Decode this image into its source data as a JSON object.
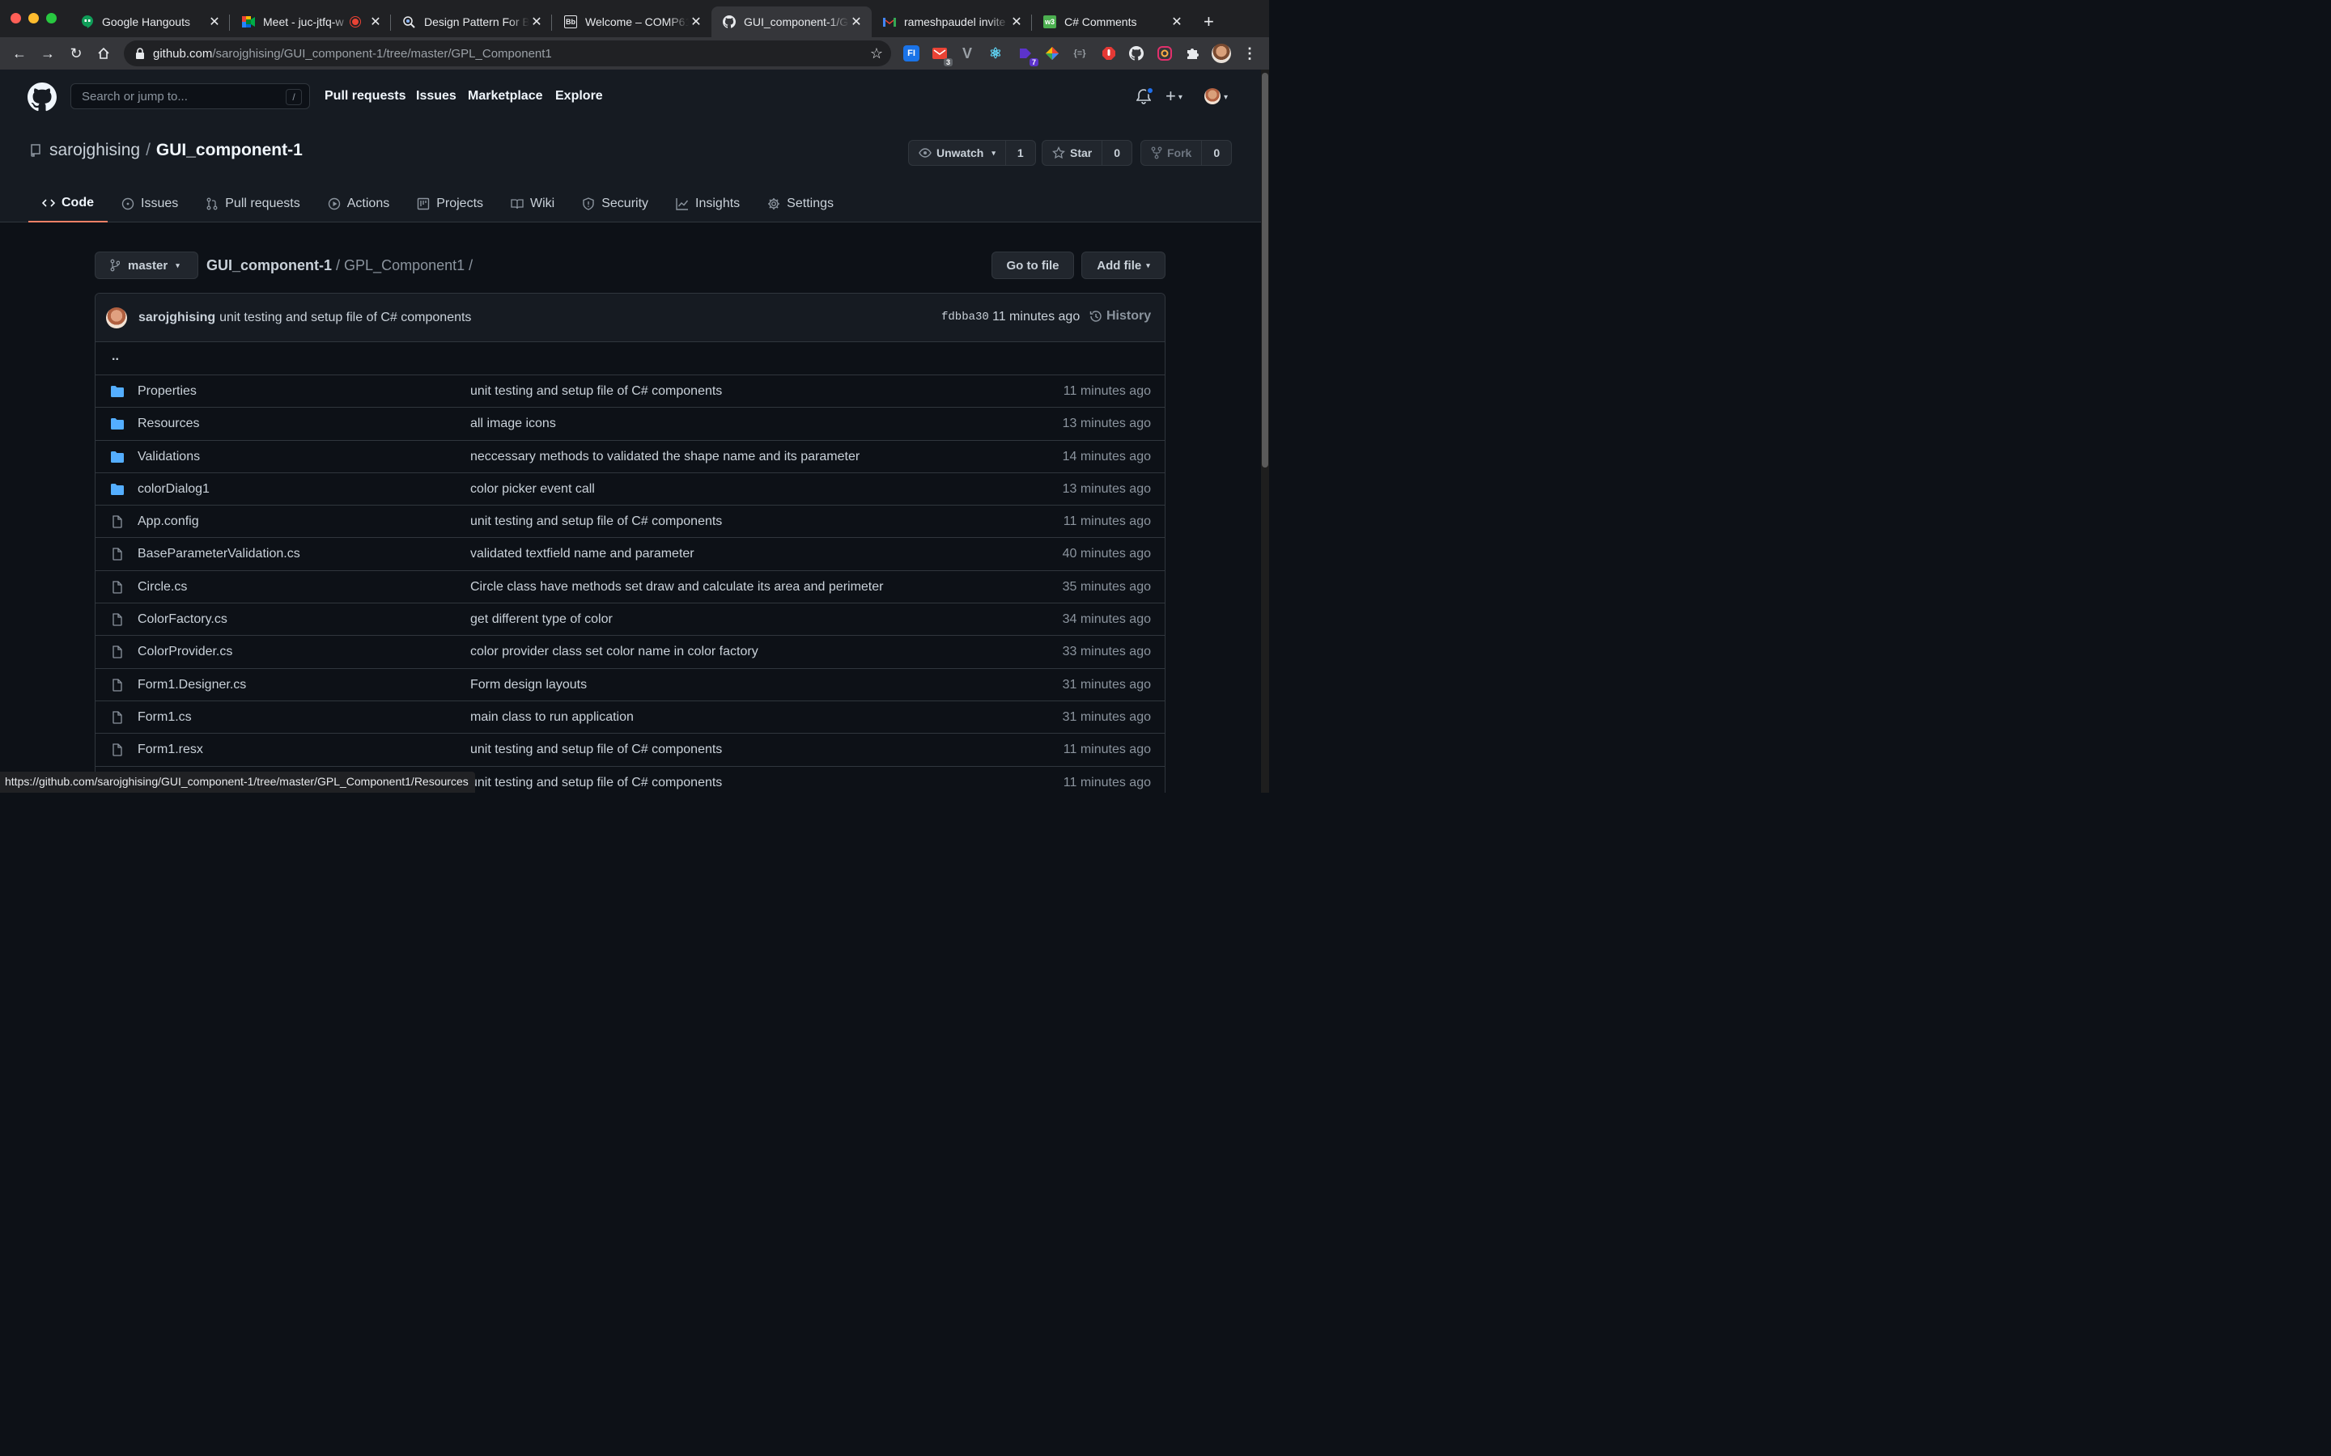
{
  "browser": {
    "tabs": [
      {
        "title": "Google Hangouts",
        "icon": "hangouts-icon"
      },
      {
        "title": "Meet - juc-jtfq-w",
        "icon": "meet-icon"
      },
      {
        "title": "Design Pattern For B",
        "icon": "design-icon"
      },
      {
        "title": "Welcome – COMP61",
        "icon": "welcome-icon"
      },
      {
        "title": "GUI_component-1/G",
        "icon": "github-icon"
      },
      {
        "title": "rameshpaudel invite",
        "icon": "gmail-icon"
      },
      {
        "title": "C# Comments",
        "icon": "csharp-icon"
      }
    ],
    "url_host": "github.com",
    "url_path": "/sarojghising/GUI_component-1/tree/master/GPL_Component1",
    "extensions": [
      "FI",
      "3",
      "7"
    ],
    "status_url": "https://github.com/sarojghising/GUI_component-1/tree/master/GPL_Component1/Resources"
  },
  "header": {
    "search_placeholder": "Search or jump to...",
    "slash": "/",
    "nav": [
      "Pull requests",
      "Issues",
      "Marketplace",
      "Explore"
    ]
  },
  "repo": {
    "owner": "sarojghising",
    "name": "GUI_component-1",
    "watch_label": "Unwatch",
    "watch_count": "1",
    "star_label": "Star",
    "star_count": "0",
    "fork_label": "Fork",
    "fork_count": "0",
    "tabs": [
      "Code",
      "Issues",
      "Pull requests",
      "Actions",
      "Projects",
      "Wiki",
      "Security",
      "Insights",
      "Settings"
    ]
  },
  "path": {
    "branch": "master",
    "root": "GUI_component-1",
    "folder": "GPL_Component1",
    "go_to_file": "Go to file",
    "add_file": "Add file"
  },
  "commit": {
    "author": "sarojghising",
    "message": "unit testing and setup file of C# components",
    "sha": "fdbba30",
    "time": "11 minutes ago",
    "history": "History"
  },
  "parent_dir": "..",
  "files": [
    {
      "type": "dir",
      "name": "Properties",
      "message": "unit testing and setup file of C# components",
      "age": "11 minutes ago"
    },
    {
      "type": "dir",
      "name": "Resources",
      "message": "all image icons",
      "age": "13 minutes ago"
    },
    {
      "type": "dir",
      "name": "Validations",
      "message": "neccessary methods to validated the shape name and its parameter",
      "age": "14 minutes ago"
    },
    {
      "type": "dir",
      "name": "colorDialog1",
      "message": "color picker event call",
      "age": "13 minutes ago"
    },
    {
      "type": "file",
      "name": "App.config",
      "message": "unit testing and setup file of C# components",
      "age": "11 minutes ago"
    },
    {
      "type": "file",
      "name": "BaseParameterValidation.cs",
      "message": "validated textfield name and parameter",
      "age": "40 minutes ago"
    },
    {
      "type": "file",
      "name": "Circle.cs",
      "message": "Circle class have methods set draw and calculate its area and perimeter",
      "age": "35 minutes ago"
    },
    {
      "type": "file",
      "name": "ColorFactory.cs",
      "message": "get different type of color",
      "age": "34 minutes ago"
    },
    {
      "type": "file",
      "name": "ColorProvider.cs",
      "message": "color provider class set color name in color factory",
      "age": "33 minutes ago"
    },
    {
      "type": "file",
      "name": "Form1.Designer.cs",
      "message": "Form design layouts",
      "age": "31 minutes ago"
    },
    {
      "type": "file",
      "name": "Form1.cs",
      "message": "main class to run application",
      "age": "31 minutes ago"
    },
    {
      "type": "file",
      "name": "Form1.resx",
      "message": "unit testing and setup file of C# components",
      "age": "11 minutes ago"
    },
    {
      "type": "file",
      "name": "",
      "message": "unit testing and setup file of C# components",
      "age": "11 minutes ago"
    }
  ],
  "colors": {
    "accent": "#f78166",
    "folder": "#54aeff",
    "link": "#58a6ff",
    "notification": "#1f6feb"
  }
}
